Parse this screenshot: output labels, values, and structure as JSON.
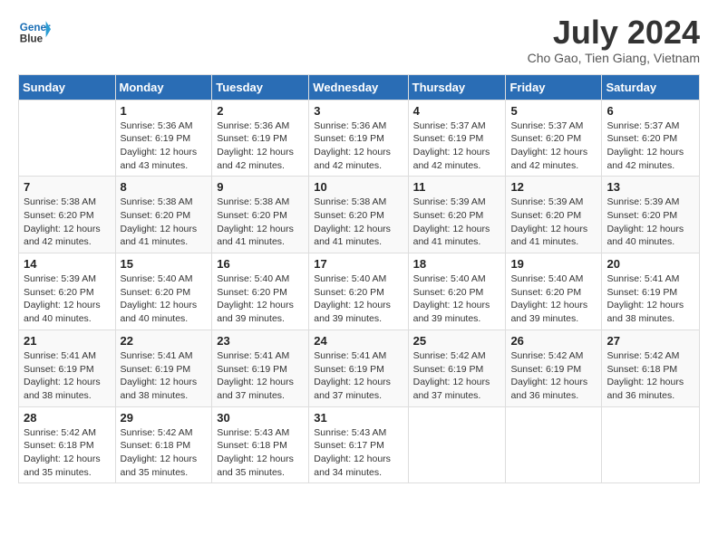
{
  "header": {
    "logo_line1": "General",
    "logo_line2": "Blue",
    "month_year": "July 2024",
    "location": "Cho Gao, Tien Giang, Vietnam"
  },
  "weekdays": [
    "Sunday",
    "Monday",
    "Tuesday",
    "Wednesday",
    "Thursday",
    "Friday",
    "Saturday"
  ],
  "weeks": [
    [
      {
        "day": "",
        "info": ""
      },
      {
        "day": "1",
        "info": "Sunrise: 5:36 AM\nSunset: 6:19 PM\nDaylight: 12 hours and 43 minutes."
      },
      {
        "day": "2",
        "info": "Sunrise: 5:36 AM\nSunset: 6:19 PM\nDaylight: 12 hours and 42 minutes."
      },
      {
        "day": "3",
        "info": "Sunrise: 5:36 AM\nSunset: 6:19 PM\nDaylight: 12 hours and 42 minutes."
      },
      {
        "day": "4",
        "info": "Sunrise: 5:37 AM\nSunset: 6:19 PM\nDaylight: 12 hours and 42 minutes."
      },
      {
        "day": "5",
        "info": "Sunrise: 5:37 AM\nSunset: 6:20 PM\nDaylight: 12 hours and 42 minutes."
      },
      {
        "day": "6",
        "info": "Sunrise: 5:37 AM\nSunset: 6:20 PM\nDaylight: 12 hours and 42 minutes."
      }
    ],
    [
      {
        "day": "7",
        "info": "Sunrise: 5:38 AM\nSunset: 6:20 PM\nDaylight: 12 hours and 42 minutes."
      },
      {
        "day": "8",
        "info": "Sunrise: 5:38 AM\nSunset: 6:20 PM\nDaylight: 12 hours and 41 minutes."
      },
      {
        "day": "9",
        "info": "Sunrise: 5:38 AM\nSunset: 6:20 PM\nDaylight: 12 hours and 41 minutes."
      },
      {
        "day": "10",
        "info": "Sunrise: 5:38 AM\nSunset: 6:20 PM\nDaylight: 12 hours and 41 minutes."
      },
      {
        "day": "11",
        "info": "Sunrise: 5:39 AM\nSunset: 6:20 PM\nDaylight: 12 hours and 41 minutes."
      },
      {
        "day": "12",
        "info": "Sunrise: 5:39 AM\nSunset: 6:20 PM\nDaylight: 12 hours and 41 minutes."
      },
      {
        "day": "13",
        "info": "Sunrise: 5:39 AM\nSunset: 6:20 PM\nDaylight: 12 hours and 40 minutes."
      }
    ],
    [
      {
        "day": "14",
        "info": "Sunrise: 5:39 AM\nSunset: 6:20 PM\nDaylight: 12 hours and 40 minutes."
      },
      {
        "day": "15",
        "info": "Sunrise: 5:40 AM\nSunset: 6:20 PM\nDaylight: 12 hours and 40 minutes."
      },
      {
        "day": "16",
        "info": "Sunrise: 5:40 AM\nSunset: 6:20 PM\nDaylight: 12 hours and 39 minutes."
      },
      {
        "day": "17",
        "info": "Sunrise: 5:40 AM\nSunset: 6:20 PM\nDaylight: 12 hours and 39 minutes."
      },
      {
        "day": "18",
        "info": "Sunrise: 5:40 AM\nSunset: 6:20 PM\nDaylight: 12 hours and 39 minutes."
      },
      {
        "day": "19",
        "info": "Sunrise: 5:40 AM\nSunset: 6:20 PM\nDaylight: 12 hours and 39 minutes."
      },
      {
        "day": "20",
        "info": "Sunrise: 5:41 AM\nSunset: 6:19 PM\nDaylight: 12 hours and 38 minutes."
      }
    ],
    [
      {
        "day": "21",
        "info": "Sunrise: 5:41 AM\nSunset: 6:19 PM\nDaylight: 12 hours and 38 minutes."
      },
      {
        "day": "22",
        "info": "Sunrise: 5:41 AM\nSunset: 6:19 PM\nDaylight: 12 hours and 38 minutes."
      },
      {
        "day": "23",
        "info": "Sunrise: 5:41 AM\nSunset: 6:19 PM\nDaylight: 12 hours and 37 minutes."
      },
      {
        "day": "24",
        "info": "Sunrise: 5:41 AM\nSunset: 6:19 PM\nDaylight: 12 hours and 37 minutes."
      },
      {
        "day": "25",
        "info": "Sunrise: 5:42 AM\nSunset: 6:19 PM\nDaylight: 12 hours and 37 minutes."
      },
      {
        "day": "26",
        "info": "Sunrise: 5:42 AM\nSunset: 6:19 PM\nDaylight: 12 hours and 36 minutes."
      },
      {
        "day": "27",
        "info": "Sunrise: 5:42 AM\nSunset: 6:18 PM\nDaylight: 12 hours and 36 minutes."
      }
    ],
    [
      {
        "day": "28",
        "info": "Sunrise: 5:42 AM\nSunset: 6:18 PM\nDaylight: 12 hours and 35 minutes."
      },
      {
        "day": "29",
        "info": "Sunrise: 5:42 AM\nSunset: 6:18 PM\nDaylight: 12 hours and 35 minutes."
      },
      {
        "day": "30",
        "info": "Sunrise: 5:43 AM\nSunset: 6:18 PM\nDaylight: 12 hours and 35 minutes."
      },
      {
        "day": "31",
        "info": "Sunrise: 5:43 AM\nSunset: 6:17 PM\nDaylight: 12 hours and 34 minutes."
      },
      {
        "day": "",
        "info": ""
      },
      {
        "day": "",
        "info": ""
      },
      {
        "day": "",
        "info": ""
      }
    ]
  ]
}
